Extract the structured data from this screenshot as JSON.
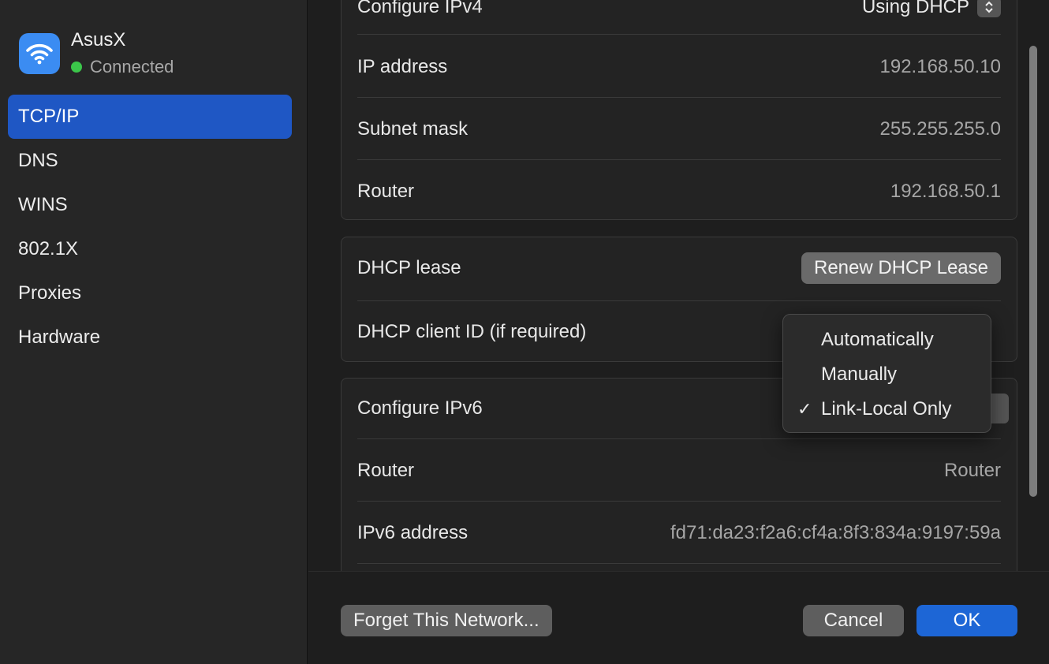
{
  "network": {
    "name": "AsusX",
    "status": "Connected",
    "icon": "wifi-icon",
    "accent_color": "#3b8cf2",
    "status_color": "#3bc64a"
  },
  "sidebar": {
    "items": [
      {
        "label": "TCP/IP",
        "selected": true
      },
      {
        "label": "DNS",
        "selected": false
      },
      {
        "label": "WINS",
        "selected": false
      },
      {
        "label": "802.1X",
        "selected": false
      },
      {
        "label": "Proxies",
        "selected": false
      },
      {
        "label": "Hardware",
        "selected": false
      }
    ]
  },
  "ipv4": {
    "configure_label": "Configure IPv4",
    "configure_value": "Using DHCP",
    "ip_label": "IP address",
    "ip_value": "192.168.50.10",
    "subnet_label": "Subnet mask",
    "subnet_value": "255.255.255.0",
    "router_label": "Router",
    "router_value": "192.168.50.1"
  },
  "dhcp": {
    "lease_label": "DHCP lease",
    "renew_button": "Renew DHCP Lease",
    "client_id_label": "DHCP client ID (if required)"
  },
  "ipv6": {
    "configure_label": "Configure IPv6",
    "router_label": "Router",
    "router_value": "Router",
    "address_label": "IPv6 address",
    "address_value": "fd71:da23:f2a6:cf4a:8f3:834a:9197:59a"
  },
  "ipv6_menu": {
    "options": [
      {
        "label": "Automatically",
        "checked": false
      },
      {
        "label": "Manually",
        "checked": false
      },
      {
        "label": "Link-Local Only",
        "checked": true
      }
    ],
    "check_glyph": "✓"
  },
  "footer": {
    "forget_label": "Forget This Network...",
    "cancel_label": "Cancel",
    "ok_label": "OK",
    "ok_color": "#1d66d6"
  }
}
